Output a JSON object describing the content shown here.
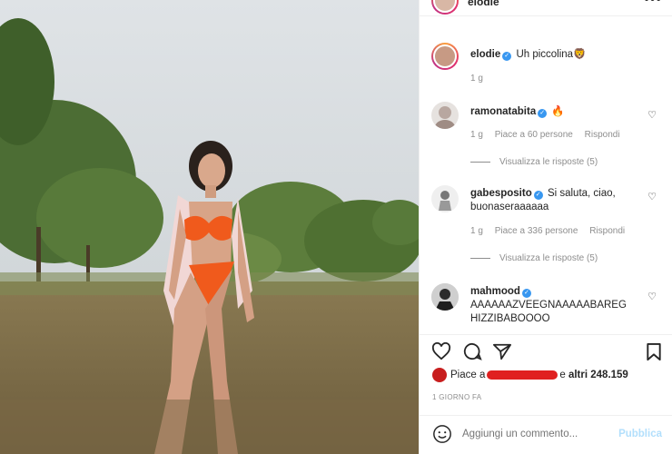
{
  "post": {
    "username": "elodie"
  },
  "caption": {
    "username": "elodie",
    "text": "Uh piccolina",
    "emoji": "🦁",
    "age": "1 g"
  },
  "comments": [
    {
      "username": "ramonatabita",
      "text": "🔥",
      "age": "1 g",
      "likes": "Piace a 60 persone",
      "reply": "Rispondi",
      "view_replies": "Visualizza le risposte (5)"
    },
    {
      "username": "gabesposito",
      "text": "Si saluta, ciao, buonaseraaaaaa",
      "age": "1 g",
      "likes": "Piace a 336 persone",
      "reply": "Rispondi",
      "view_replies": "Visualizza le risposte (5)"
    },
    {
      "username": "mahmood",
      "text": "AAAAAAZVEEGNAAAAABAREGHIZZIBABOOOO"
    }
  ],
  "likes": {
    "prefix": "Piace a",
    "suffix": "e",
    "others": "altri 248.159"
  },
  "time_ago": "1 GIORNO FA",
  "add_comment": {
    "placeholder": "Aggiungi un commento...",
    "publish": "Pubblica"
  },
  "colors": {
    "verified": "#3897f0",
    "publish_disabled": "#b2dffc",
    "secondary_text": "#8e8e8e"
  }
}
